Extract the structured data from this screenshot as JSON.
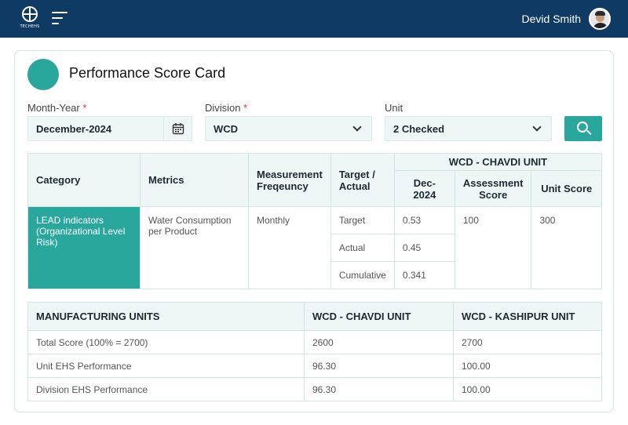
{
  "header": {
    "logo_text": "TECHEHS",
    "user_name": "Devid Smith"
  },
  "page": {
    "title": "Performance Score Card"
  },
  "filters": {
    "month_year": {
      "label": "Month-Year",
      "required": "*",
      "value": "December-2024"
    },
    "division": {
      "label": "Division",
      "required": "*",
      "value": "WCD"
    },
    "unit": {
      "label": "Unit",
      "value": "2 Checked"
    }
  },
  "score_table": {
    "headers": {
      "category": "Category",
      "metrics": "Metrics",
      "measurement": "Measurement Freqeuncy",
      "target_actual": "Target / Actual",
      "unit_group": "WCD - CHAVDI UNIT",
      "period": "Dec-2024",
      "assessment": "Assessment Score",
      "unit_score": "Unit Score"
    },
    "row": {
      "category": "LEAD indicators (Organizational Level Risk)",
      "metric": "Water Consumption per Product",
      "frequency": "Monthly",
      "assessment": "100",
      "unit_score": "300",
      "sub_rows": [
        {
          "label": "Target",
          "value": "0.53"
        },
        {
          "label": "Actual",
          "value": "0.45"
        },
        {
          "label": "Cumulative",
          "value": "0.341"
        }
      ]
    }
  },
  "units_table": {
    "headers": [
      "MANUFACTURING UNITS",
      "WCD - CHAVDI UNIT",
      "WCD - KASHIPUR UNIT"
    ],
    "rows": [
      [
        "Total Score (100% = 2700)",
        "2600",
        "2700"
      ],
      [
        "Unit EHS Performance",
        "96.30",
        "100.00"
      ],
      [
        "Division EHS Performance",
        "96.30",
        "100.00"
      ]
    ]
  }
}
